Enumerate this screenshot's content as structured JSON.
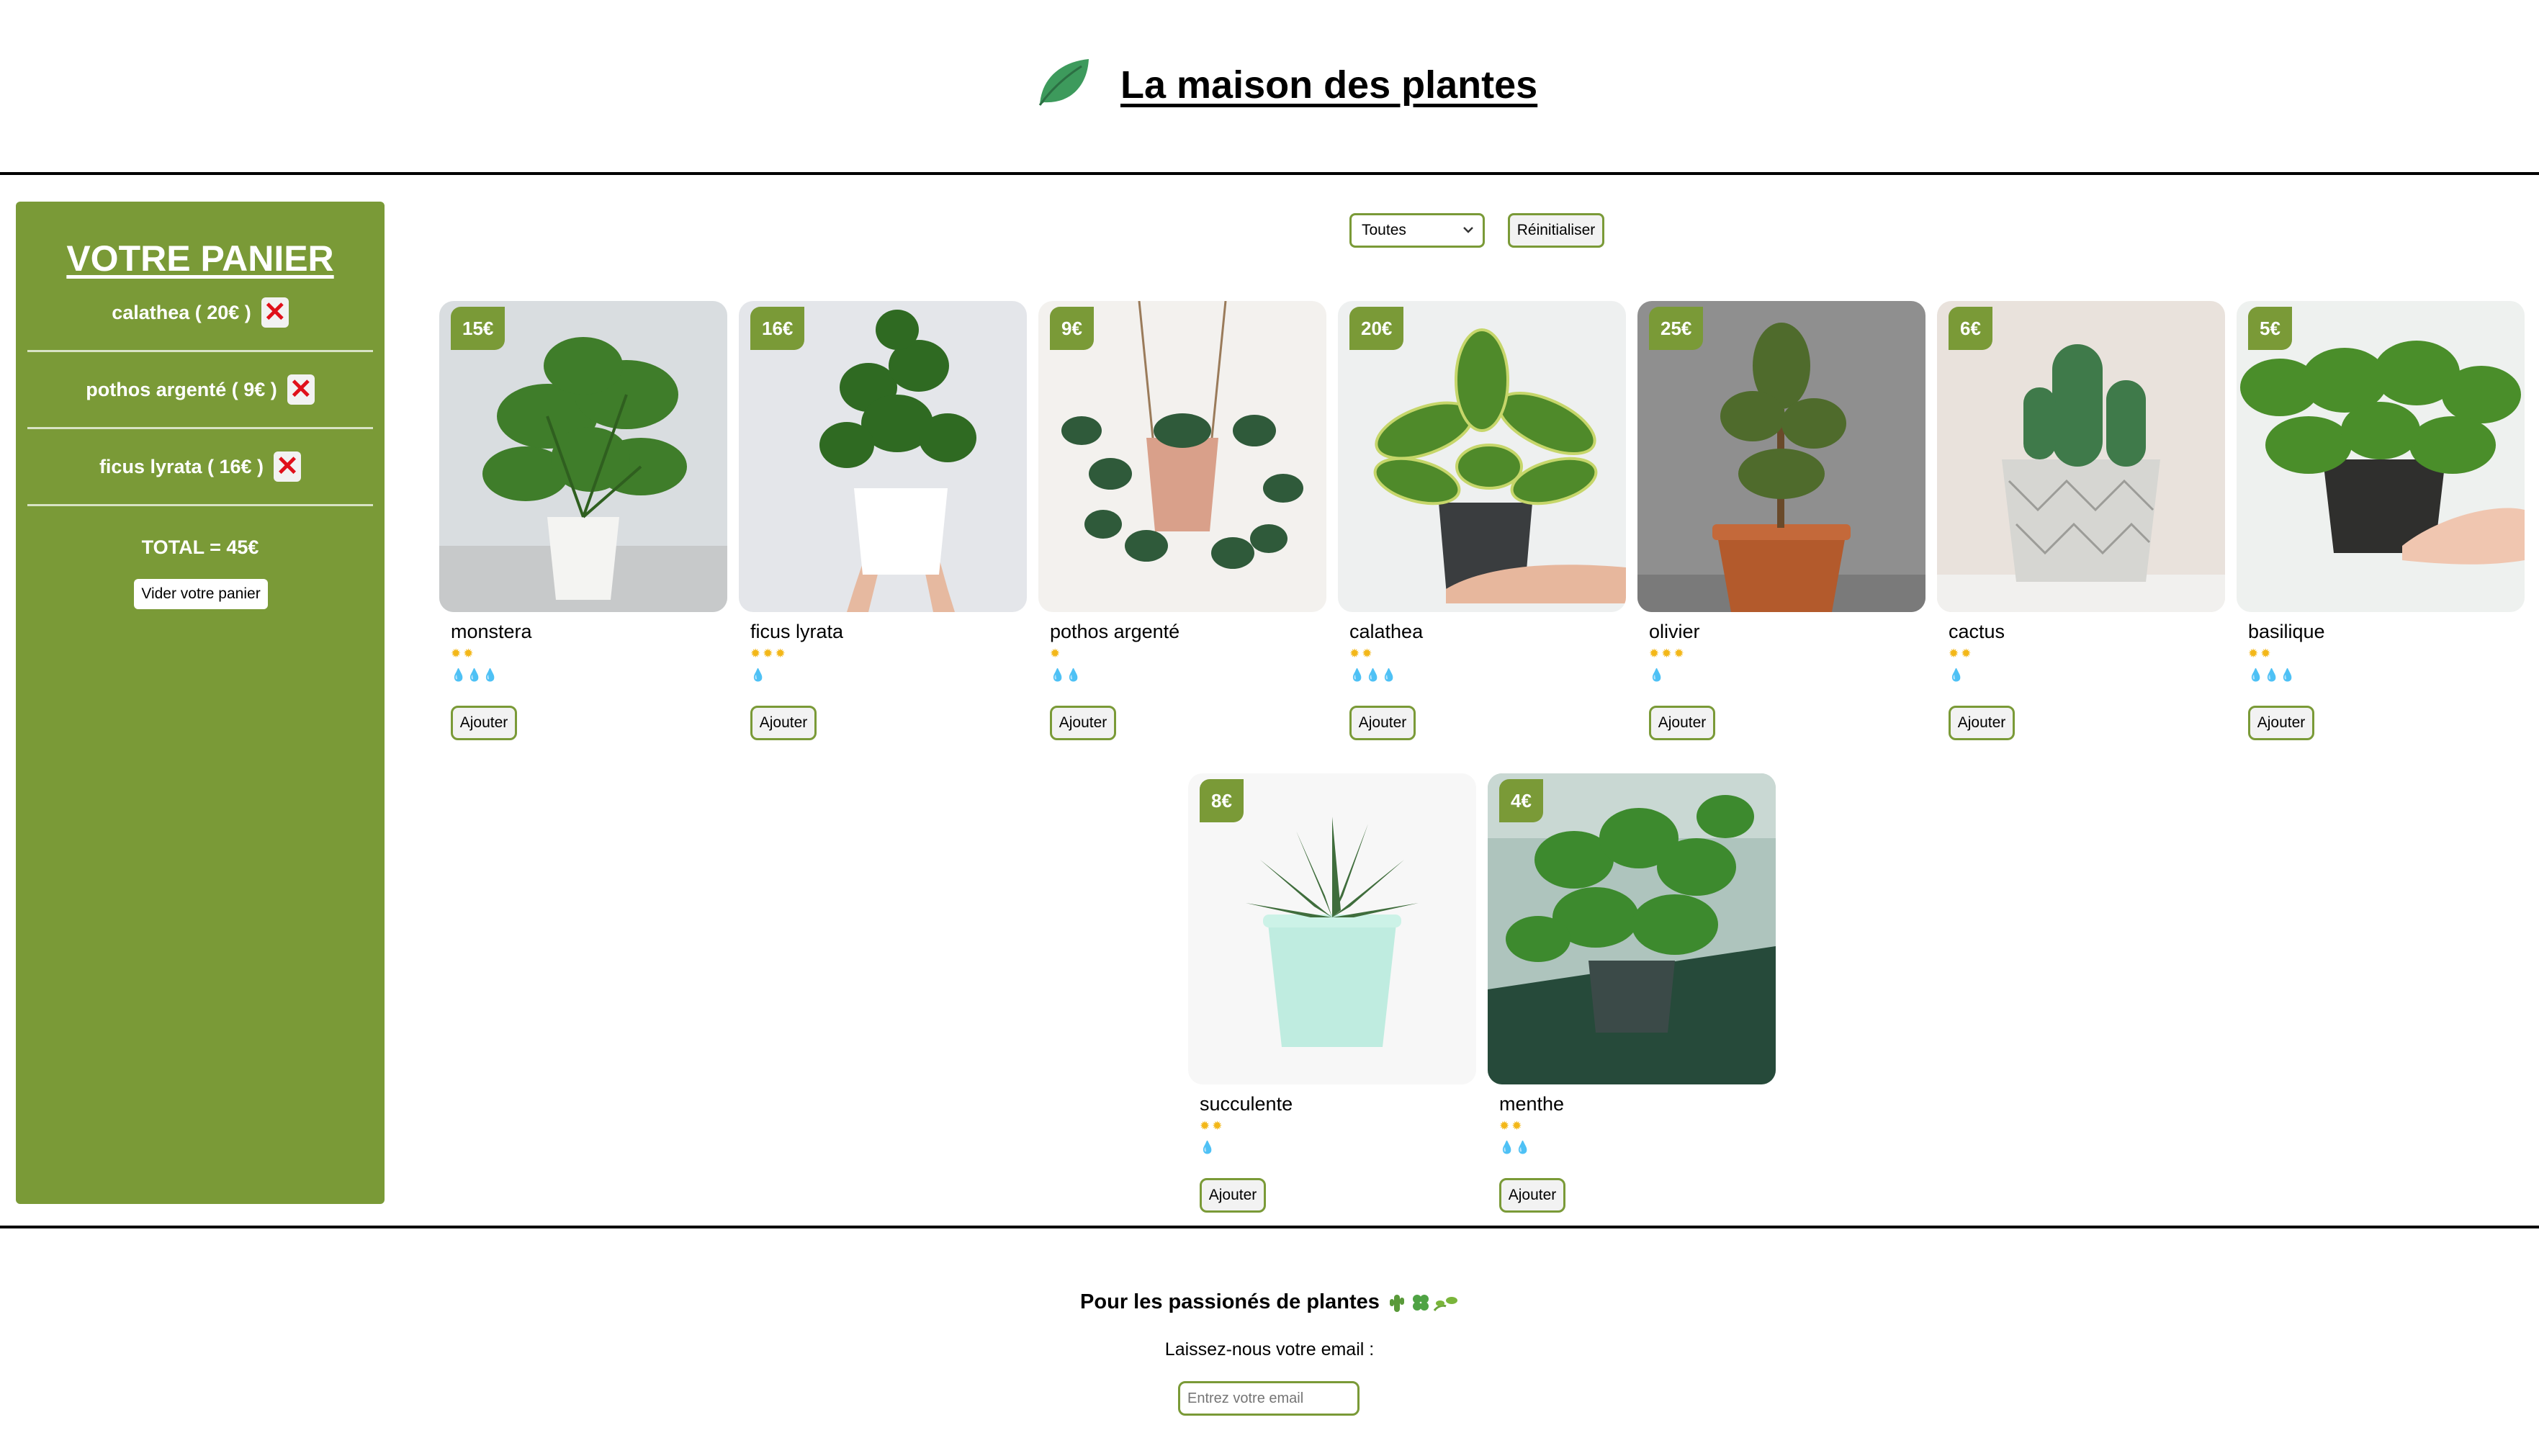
{
  "header": {
    "title": "La maison des plantes",
    "logo_icon": "leaf-icon"
  },
  "cart": {
    "title": "VOTRE PANIER",
    "items": [
      {
        "label": "calathea ( 20€ )"
      },
      {
        "label": "pothos argenté ( 9€ )"
      },
      {
        "label": "ficus lyrata ( 16€ )"
      }
    ],
    "remove_icon": "✕",
    "total": "TOTAL = 45€",
    "empty_label": "Vider votre panier"
  },
  "filter": {
    "selected": "Toutes",
    "reset_label": "Réinitialiser"
  },
  "plants": [
    {
      "price": "15€",
      "name": "monstera",
      "light": "✹✹",
      "water": "💧💧💧",
      "add_label": "Ajouter"
    },
    {
      "price": "16€",
      "name": "ficus lyrata",
      "light": "✹✹✹",
      "water": "💧",
      "add_label": "Ajouter"
    },
    {
      "price": "9€",
      "name": "pothos argenté",
      "light": "✹",
      "water": "💧💧",
      "add_label": "Ajouter"
    },
    {
      "price": "20€",
      "name": "calathea",
      "light": "✹✹",
      "water": "💧💧💧",
      "add_label": "Ajouter"
    },
    {
      "price": "25€",
      "name": "olivier",
      "light": "✹✹✹",
      "water": "💧",
      "add_label": "Ajouter"
    },
    {
      "price": "6€",
      "name": "cactus",
      "light": "✹✹",
      "water": "💧",
      "add_label": "Ajouter"
    },
    {
      "price": "5€",
      "name": "basilique",
      "light": "✹✹",
      "water": "💧💧💧",
      "add_label": "Ajouter"
    },
    {
      "price": "8€",
      "name": "succulente",
      "light": "✹✹",
      "water": "💧",
      "add_label": "Ajouter"
    },
    {
      "price": "4€",
      "name": "menthe",
      "light": "✹✹",
      "water": "💧💧",
      "add_label": "Ajouter"
    }
  ],
  "footer": {
    "title": "Pour les passionés de plantes",
    "subtitle": "Laissez-nous votre email :",
    "email_placeholder": "Entrez votre email"
  }
}
